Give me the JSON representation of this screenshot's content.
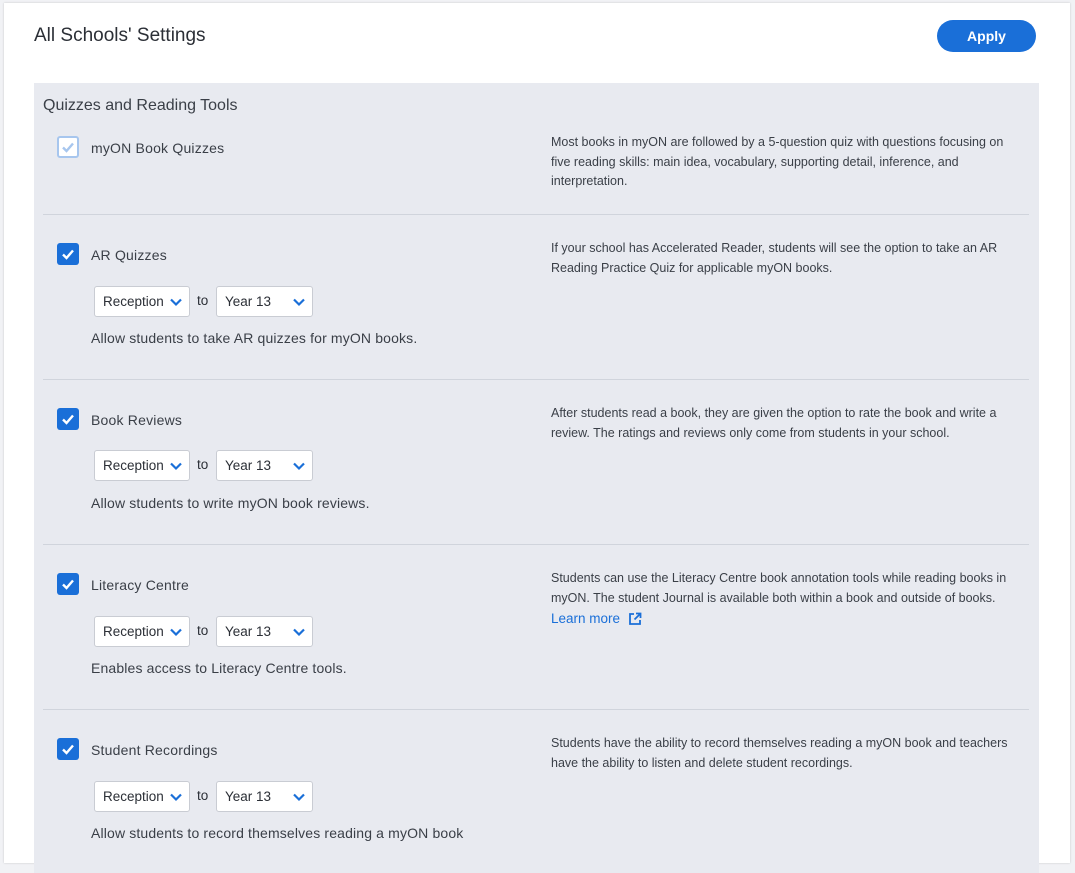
{
  "header": {
    "title": "All Schools' Settings",
    "apply_label": "Apply"
  },
  "section": {
    "title": "Quizzes and Reading Tools"
  },
  "settings": [
    {
      "label": "myON Book Quizzes",
      "checked": true,
      "disabled": true,
      "description": "Most books in myON are followed by a 5-question quiz with questions focusing on five reading skills: main idea, vocabulary, supporting detail, inference, and interpretation."
    },
    {
      "label": "AR Quizzes",
      "checked": true,
      "from": "Reception",
      "to_word": "to",
      "to": "Year 13",
      "help": "Allow students to take AR quizzes for myON books.",
      "description": "If your school has Accelerated Reader, students will see the option to take an AR Reading Practice Quiz for applicable myON books."
    },
    {
      "label": "Book Reviews",
      "checked": true,
      "from": "Reception",
      "to_word": "to",
      "to": "Year 13",
      "help": "Allow students to write myON book reviews.",
      "description": "After students read a book, they are given the option to rate the book and write a review. The ratings and reviews only come from students in your school."
    },
    {
      "label": "Literacy Centre",
      "checked": true,
      "from": "Reception",
      "to_word": "to",
      "to": "Year 13",
      "help": "Enables access to Literacy Centre tools.",
      "description": "Students can use the Literacy Centre book annotation tools while reading books in myON. The student Journal is available both within a book and outside of books.",
      "link_label": "Learn more"
    },
    {
      "label": "Student Recordings",
      "checked": true,
      "from": "Reception",
      "to_word": "to",
      "to": "Year 13",
      "help": "Allow students to record themselves reading a myON book",
      "description": "Students have the ability to record themselves reading a myON book and teachers have the ability to listen and delete student recordings."
    }
  ],
  "colors": {
    "accent": "#1a6fd8",
    "panel": "#e8eaf0"
  },
  "icons": {
    "check": "check-icon",
    "chevron": "chevron-down-icon",
    "external": "external-link-icon"
  }
}
